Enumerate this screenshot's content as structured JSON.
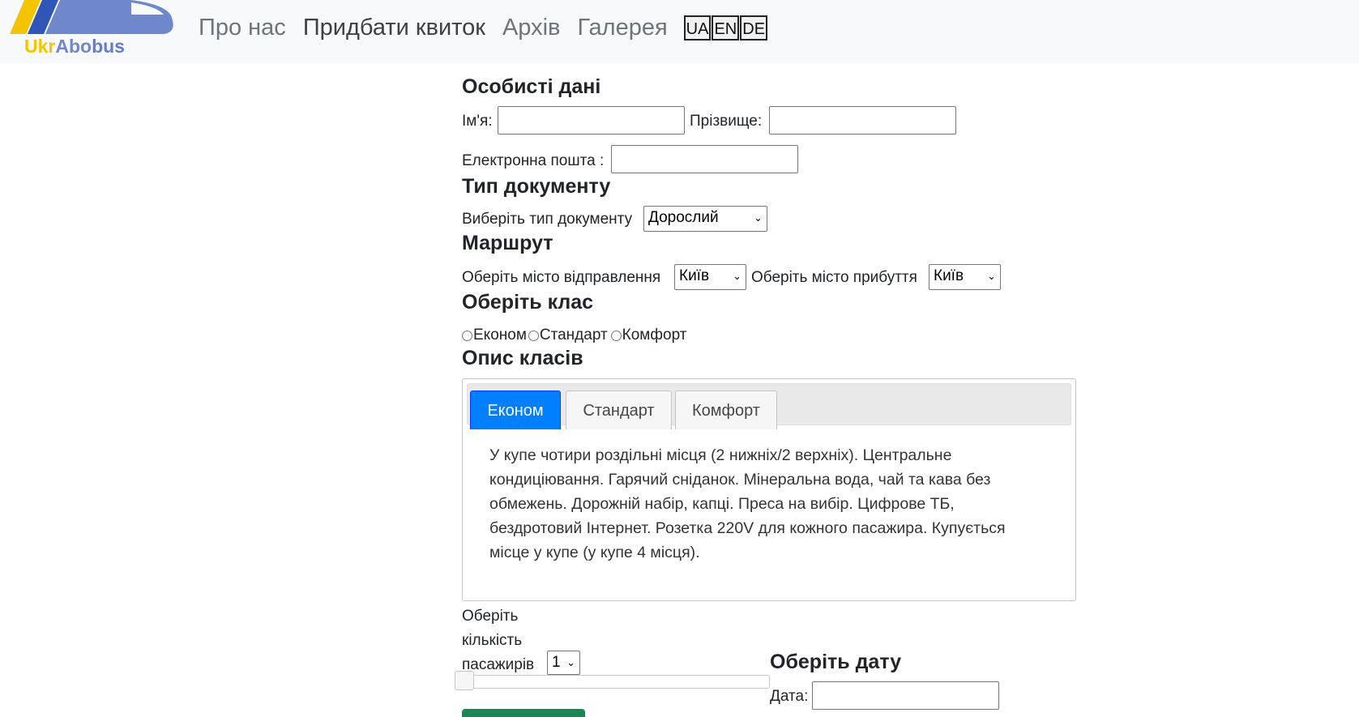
{
  "brand": {
    "logo_part1": "Ukr",
    "logo_part2": "Abo",
    "logo_part3": "bus",
    "colors": {
      "yellow": "#f5c400",
      "blue": "#6f88cc"
    }
  },
  "nav": {
    "links": [
      "Про нас",
      "Придбати квиток",
      "Архів",
      "Галерея"
    ],
    "languages": [
      "UA",
      "EN",
      "DE"
    ]
  },
  "personal": {
    "heading": "Особисті дані",
    "first_name_label": "Ім'я:",
    "last_name_label": "Прізвище:",
    "email_label": "Електронна пошта :"
  },
  "document": {
    "heading": "Тип документу",
    "select_label": "Виберіть тип документу",
    "selected": "Дорослий"
  },
  "route": {
    "heading": "Маршрут",
    "departure_label": "Оберіть місто відправлення",
    "departure_value": "Київ",
    "arrival_label": "Оберіть місто прибуття",
    "arrival_value": "Київ"
  },
  "class_select": {
    "heading": "Оберіть клас",
    "options": [
      "Економ",
      "Стандарт",
      "Комфорт"
    ]
  },
  "class_desc": {
    "heading": "Опис класів",
    "tabs": [
      "Економ",
      "Стандарт",
      "Комфорт"
    ],
    "active_tab": "Економ",
    "text": "У купе чотири роздільні місця (2 нижніх/2 верхніх). Центральне кондиціювання. Гарячий сніданок. Мінеральна вода, чай та кава без обмежень. Дорожній набір, капці. Преса на вибір. Цифрове ТБ, бездротовий Інтернет. Розетка 220V для кожного пасажира. Купується місце у купе (у купе 4 місця)."
  },
  "passengers": {
    "label_line1": "Оберіть",
    "label_line2": "кількість",
    "label_line3": "пасажирів",
    "selected": "1",
    "slider_value": 1
  },
  "date": {
    "heading": "Оберіть дату",
    "label": "Дата:"
  },
  "ui_colors": {
    "accent": "#007fff",
    "submit": "#198754"
  }
}
